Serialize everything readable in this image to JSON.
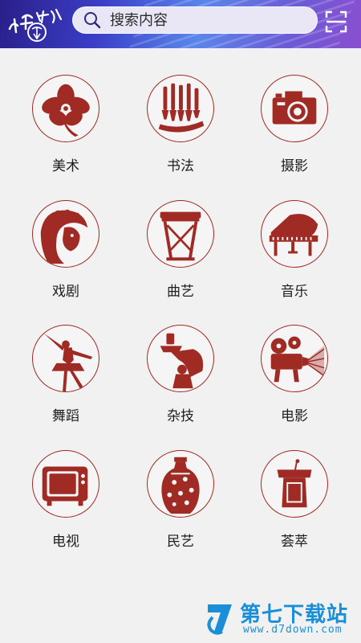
{
  "header": {
    "logo_text": "山東數字",
    "search": {
      "placeholder": "搜索内容"
    }
  },
  "categories": [
    {
      "label": "美术",
      "icon": "flower-papercut-icon"
    },
    {
      "label": "书法",
      "icon": "brushes-papercut-icon"
    },
    {
      "label": "摄影",
      "icon": "camera-papercut-icon"
    },
    {
      "label": "戏剧",
      "icon": "opera-mask-papercut-icon"
    },
    {
      "label": "曲艺",
      "icon": "drum-papercut-icon"
    },
    {
      "label": "音乐",
      "icon": "piano-papercut-icon"
    },
    {
      "label": "舞蹈",
      "icon": "dancer-papercut-icon"
    },
    {
      "label": "杂技",
      "icon": "acrobat-papercut-icon"
    },
    {
      "label": "电影",
      "icon": "projector-papercut-icon"
    },
    {
      "label": "电视",
      "icon": "television-papercut-icon"
    },
    {
      "label": "民艺",
      "icon": "vase-papercut-icon"
    },
    {
      "label": "荟萃",
      "icon": "podium-papercut-icon"
    }
  ],
  "watermark": {
    "title": "第七下载站",
    "url": "www.d7down.com"
  },
  "colors": {
    "accent": "#a02a24",
    "header_start": "#2a1f8a",
    "header_end": "#8a4fd0",
    "watermark": "#1a8fd8"
  }
}
